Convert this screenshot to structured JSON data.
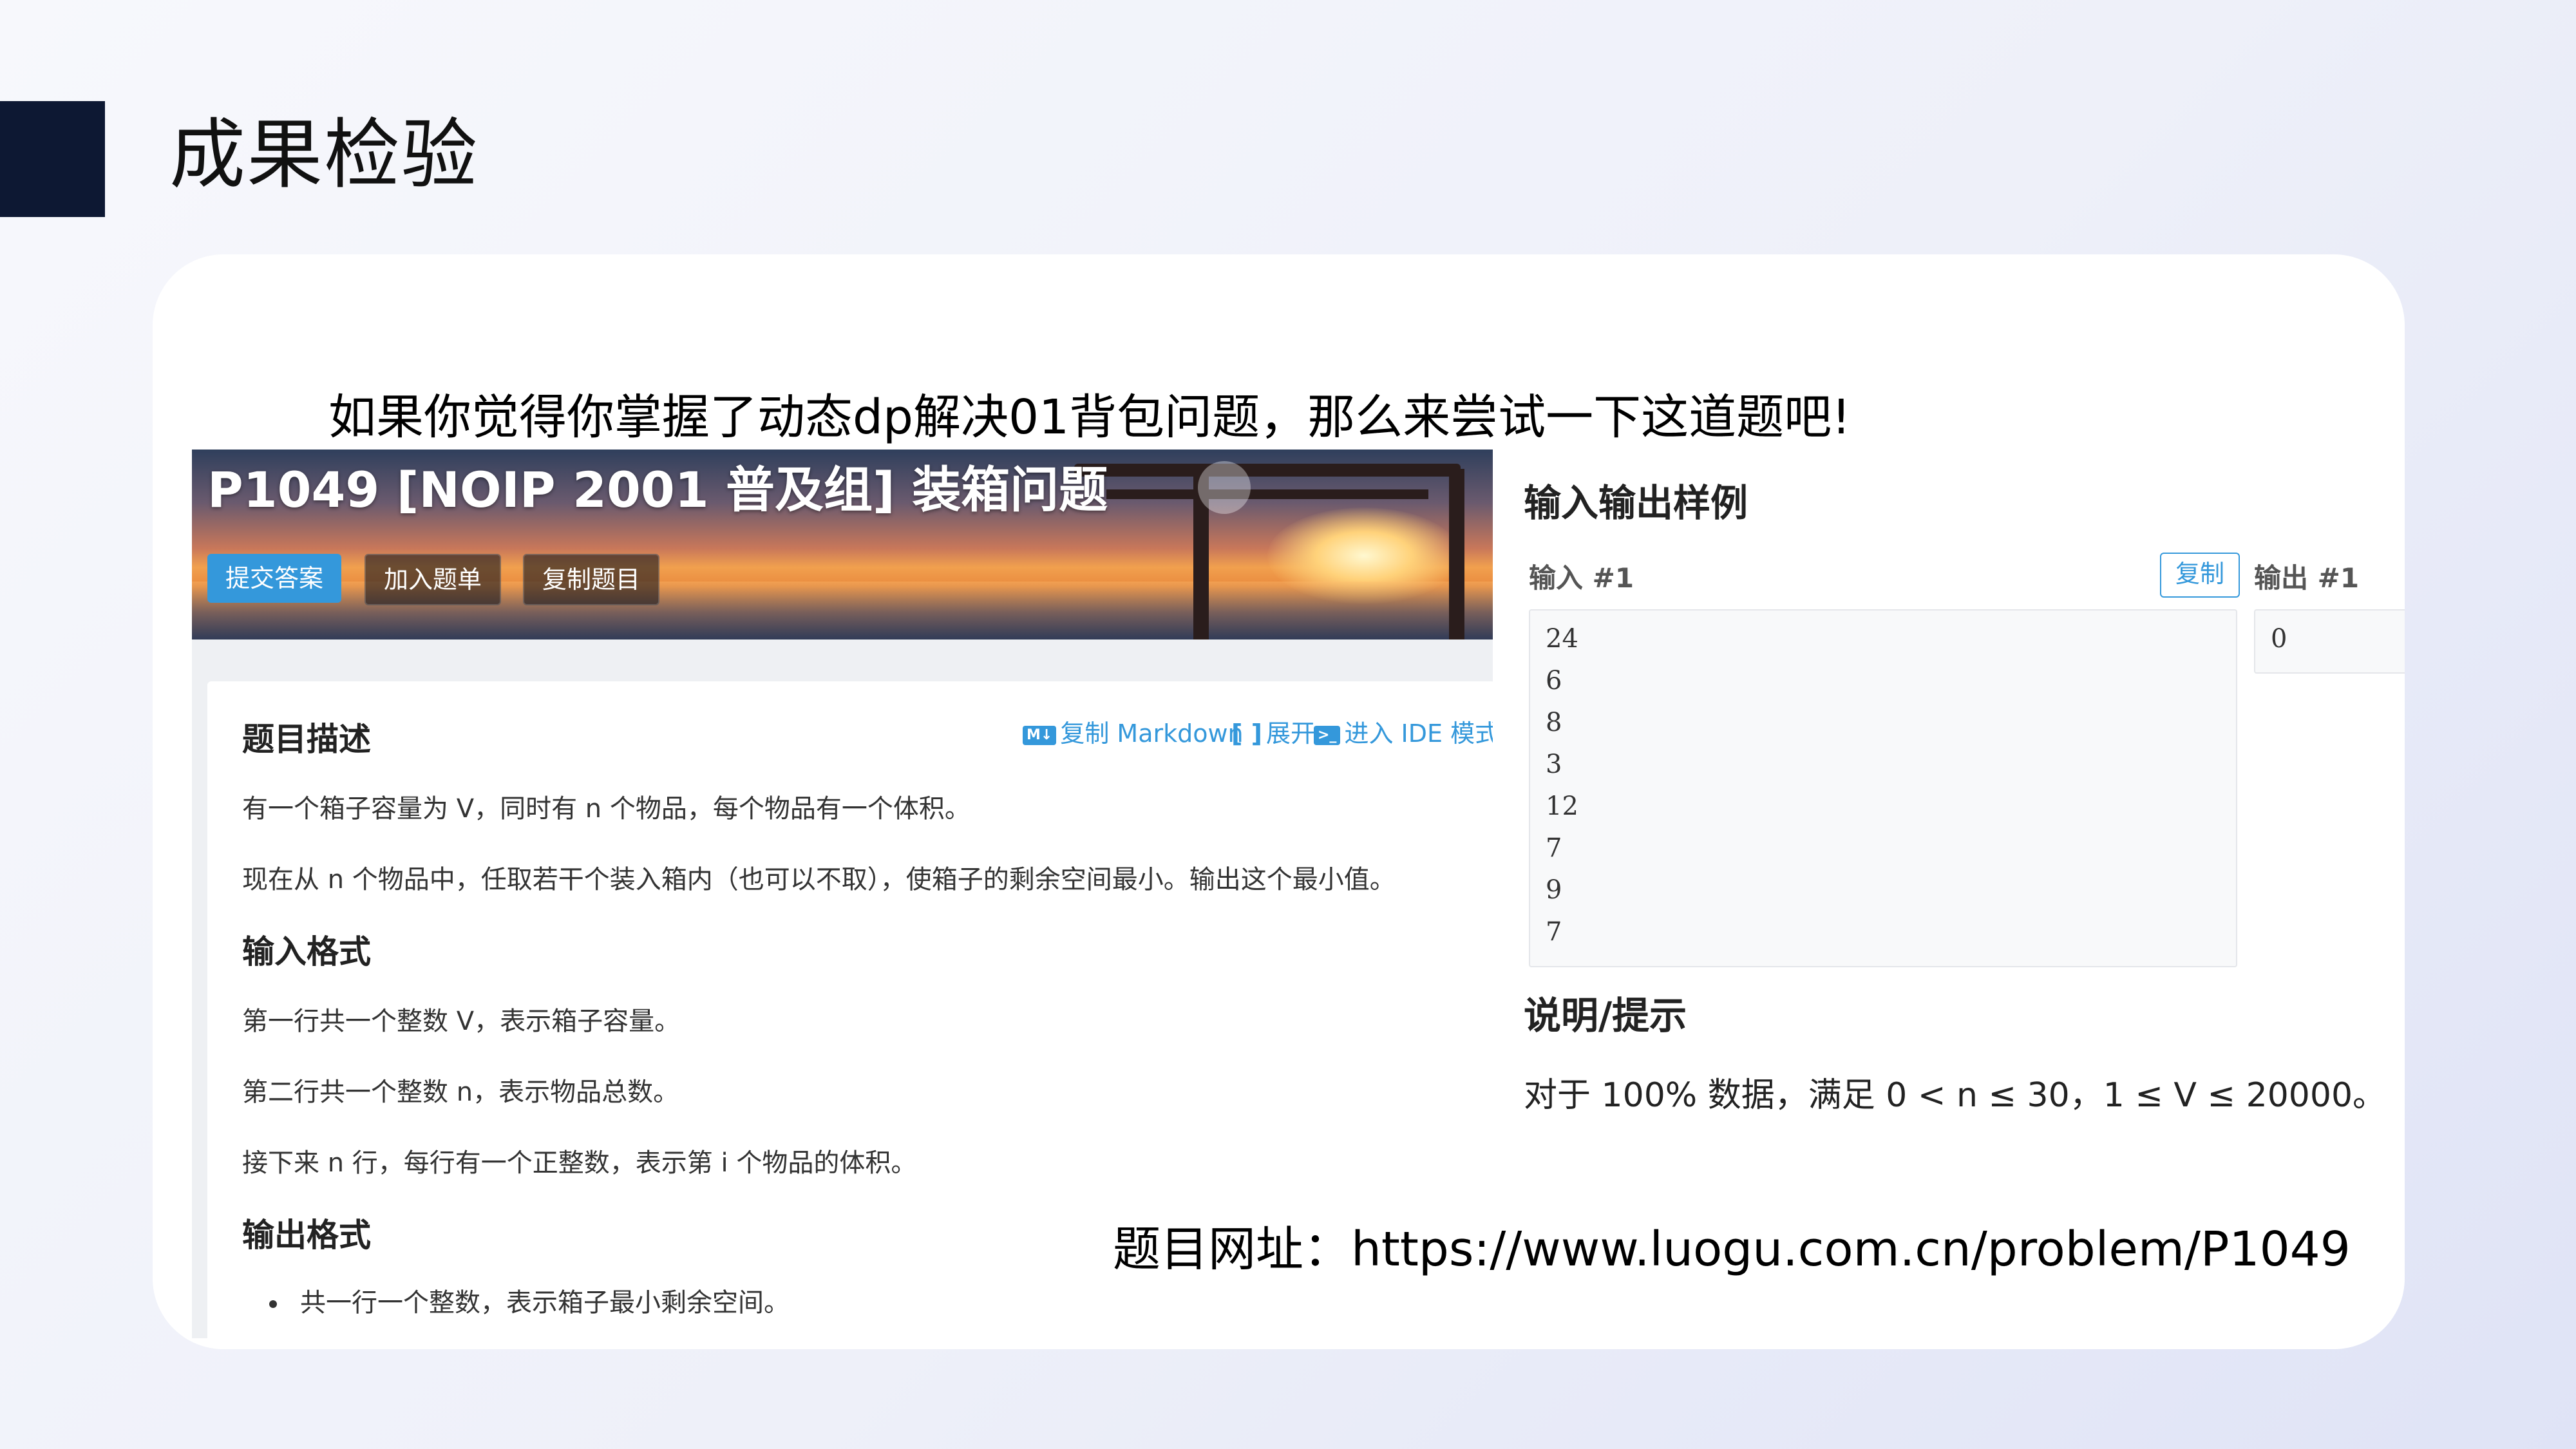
{
  "slide": {
    "title": "成果检验",
    "intro": "如果你觉得你掌握了动态dp解决01背包问题，那么来尝试一下这道题吧!",
    "url_line": "题目网址：https://www.luogu.com.cn/problem/P1049"
  },
  "problem": {
    "title": "P1049 [NOIP 2001 普及组] 装箱问题",
    "buttons": [
      "提交答案",
      "加入题单",
      "复制题目"
    ],
    "tools": {
      "copy_markdown": "复制 Markdown",
      "expand": "展开",
      "ide_mode": "进入 IDE 模式",
      "md_icon": "M↓",
      "ide_icon": ">_",
      "expand_icon": "[ ]"
    },
    "sections": {
      "description": {
        "heading": "题目描述",
        "lines": [
          "有一个箱子容量为 V，同时有 n 个物品，每个物品有一个体积。",
          "现在从 n 个物品中，任取若干个装入箱内（也可以不取），使箱子的剩余空间最小。输出这个最小值。"
        ]
      },
      "input_format": {
        "heading": "输入格式",
        "lines": [
          "第一行共一个整数 V，表示箱子容量。",
          "第二行共一个整数 n，表示物品总数。",
          "接下来 n 行，每行有一个正整数，表示第 i 个物品的体积。"
        ]
      },
      "output_format": {
        "heading": "输出格式",
        "bullet": "共一行一个整数，表示箱子最小剩余空间。"
      }
    }
  },
  "samples": {
    "heading": "输入输出样例",
    "input_label": "输入 #1",
    "output_label": "输出 #1",
    "copy_button": "复制",
    "input_lines": [
      "24",
      "6",
      "8",
      "3",
      "12",
      "7",
      "9",
      "7"
    ],
    "output_lines": [
      "0"
    ]
  },
  "hint": {
    "heading": "说明/提示",
    "text": "对于 100% 数据，满足 0 < n ≤ 30，1 ≤ V ≤ 20000。"
  },
  "colors": {
    "accent": "#3498db",
    "title_block": "#0d1833"
  }
}
